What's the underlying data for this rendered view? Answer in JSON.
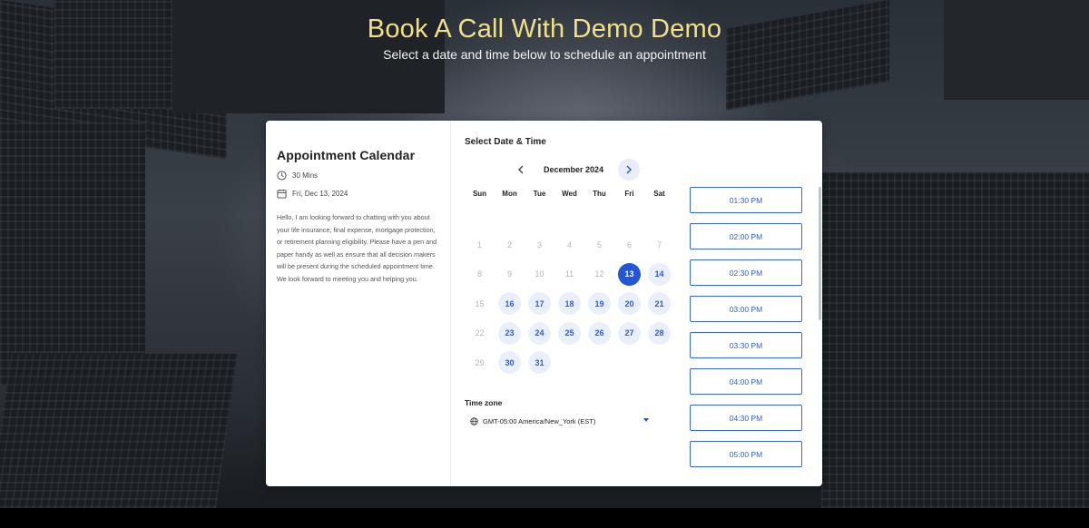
{
  "hero": {
    "title": "Book A Call With Demo Demo",
    "subtitle": "Select a date and time below to schedule an appointment"
  },
  "left": {
    "title": "Appointment Calendar",
    "duration": "30 Mins",
    "date": "Fri, Dec 13, 2024",
    "description": "Hello, I am looking forward to chatting with you about your life insurance, final expense, mortgage protection, or retirement planning eligibility. Please have a pen and paper handy as well as ensure that all decision makers will be present during the scheduled appointment time. We look forward to meeting you and helping you.",
    "icons": {
      "duration": "clock-icon",
      "date": "calendar-icon"
    }
  },
  "calendar": {
    "section_title": "Select Date & Time",
    "month_label": "December 2024",
    "weekdays": [
      "Sun",
      "Mon",
      "Tue",
      "Wed",
      "Thu",
      "Fri",
      "Sat"
    ],
    "weeks": [
      [
        {
          "d": "",
          "s": "empty"
        },
        {
          "d": "",
          "s": "empty"
        },
        {
          "d": "",
          "s": "empty"
        },
        {
          "d": "",
          "s": "empty"
        },
        {
          "d": "",
          "s": "empty"
        },
        {
          "d": "",
          "s": "empty"
        },
        {
          "d": "",
          "s": "empty"
        }
      ],
      [
        {
          "d": "1",
          "s": "disabled"
        },
        {
          "d": "2",
          "s": "disabled"
        },
        {
          "d": "3",
          "s": "disabled"
        },
        {
          "d": "4",
          "s": "disabled"
        },
        {
          "d": "5",
          "s": "disabled"
        },
        {
          "d": "6",
          "s": "disabled"
        },
        {
          "d": "7",
          "s": "disabled"
        }
      ],
      [
        {
          "d": "8",
          "s": "disabled"
        },
        {
          "d": "9",
          "s": "disabled"
        },
        {
          "d": "10",
          "s": "disabled"
        },
        {
          "d": "11",
          "s": "disabled"
        },
        {
          "d": "12",
          "s": "disabled"
        },
        {
          "d": "13",
          "s": "selected"
        },
        {
          "d": "14",
          "s": "available"
        }
      ],
      [
        {
          "d": "15",
          "s": "disabled"
        },
        {
          "d": "16",
          "s": "available"
        },
        {
          "d": "17",
          "s": "available"
        },
        {
          "d": "18",
          "s": "available"
        },
        {
          "d": "19",
          "s": "available"
        },
        {
          "d": "20",
          "s": "available"
        },
        {
          "d": "21",
          "s": "available"
        }
      ],
      [
        {
          "d": "22",
          "s": "disabled"
        },
        {
          "d": "23",
          "s": "available"
        },
        {
          "d": "24",
          "s": "available"
        },
        {
          "d": "25",
          "s": "available"
        },
        {
          "d": "26",
          "s": "available"
        },
        {
          "d": "27",
          "s": "available"
        },
        {
          "d": "28",
          "s": "available"
        }
      ],
      [
        {
          "d": "29",
          "s": "disabled"
        },
        {
          "d": "30",
          "s": "available"
        },
        {
          "d": "31",
          "s": "available"
        },
        {
          "d": "",
          "s": "empty"
        },
        {
          "d": "",
          "s": "empty"
        },
        {
          "d": "",
          "s": "empty"
        },
        {
          "d": "",
          "s": "empty"
        }
      ]
    ],
    "timezone_label": "Time zone",
    "timezone_value": "GMT-05:00 America/New_York (EST)"
  },
  "slots": [
    "01:30 PM",
    "02:00 PM",
    "02:30 PM",
    "03:00 PM",
    "03:30 PM",
    "04:00 PM",
    "04:30 PM",
    "05:00 PM"
  ],
  "colors": {
    "hero_title": "#f0e08a",
    "accent": "#2256d4",
    "available_bg": "#eaf0fb",
    "disabled_text": "#b3b6bc"
  }
}
